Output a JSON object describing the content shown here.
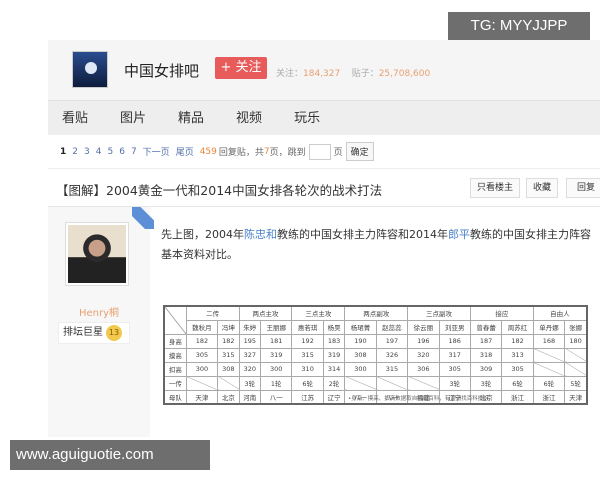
{
  "watermark_top": "TG: MYYJJPP",
  "watermark_bottom": "www.aguiguotie.com",
  "forum": {
    "name": "中国女排吧",
    "follow_label": "+ 关注",
    "followers_label": "关注：",
    "followers": "184,327",
    "posts_label": "贴子：",
    "posts": "25,708,600"
  },
  "nav": [
    "看贴",
    "图片",
    "精品",
    "视频",
    "玩乐"
  ],
  "pager": {
    "pages": [
      "1",
      "2",
      "3",
      "4",
      "5",
      "6",
      "7"
    ],
    "next": "下一页",
    "last": "尾页",
    "replies": "459",
    "replies_label": "回复贴，共",
    "total_pages": "7",
    "jump_label": "页，跳到",
    "page_unit": "页",
    "confirm": "确定"
  },
  "thread": {
    "title": "【图解】2004黄金一代和2014中国女排各轮次的战术打法",
    "buttons": [
      "只看楼主",
      "收藏",
      "回复"
    ]
  },
  "author": {
    "name": "Henry桐",
    "title": "排坛巨星",
    "level": "13",
    "ribbon": "楼主"
  },
  "post": {
    "t1": "先上图，2004年",
    "l1": "陈忠和",
    "t2": "教练的中国女排主力阵容和2014年",
    "l2": "郎平",
    "t3": "教练的中国女排主力阵容基本资料对比。"
  },
  "table": {
    "groups": [
      "二传",
      "两点主攻",
      "三点主攻",
      "两点副攻",
      "三点副攻",
      "接应",
      "自由人"
    ],
    "players": [
      "魏秋月",
      "冯坤",
      "朱婷",
      "王丽娜",
      "惠若琪",
      "杨昊",
      "杨珺菁",
      "赵蕊蕊",
      "徐云丽",
      "刘亚男",
      "曾春蕾",
      "周苏红",
      "单丹娜",
      "张娜"
    ],
    "rows": [
      {
        "label": "身高",
        "cells": [
          "182",
          "182",
          "195",
          "181",
          "192",
          "183",
          "190",
          "197",
          "196",
          "186",
          "187",
          "182",
          "168",
          "180"
        ]
      },
      {
        "label": "摸高",
        "cells": [
          "305",
          "315",
          "327",
          "319",
          "315",
          "319",
          "308",
          "326",
          "320",
          "317",
          "318",
          "313",
          "",
          ""
        ]
      },
      {
        "label": "扣高",
        "cells": [
          "300",
          "308",
          "320",
          "300",
          "310",
          "314",
          "300",
          "315",
          "306",
          "305",
          "309",
          "305",
          "",
          ""
        ]
      },
      {
        "label": "一传",
        "cells": [
          "",
          "",
          "3轮",
          "1轮",
          "6轮",
          "2轮",
          "",
          "",
          "",
          "3轮",
          "3轮",
          "6轮",
          "6轮",
          "5轮"
        ]
      },
      {
        "label": "母队",
        "cells": [
          "天津",
          "北京",
          "河南",
          "八一",
          "江苏",
          "辽宁",
          "八一",
          "八一",
          "福建",
          "辽宁",
          "北京",
          "浙江",
          "浙江",
          "天津"
        ]
      }
    ],
    "note": "•身高、摸高、扣高数据取自网络百科，有误请找百科投诉"
  }
}
